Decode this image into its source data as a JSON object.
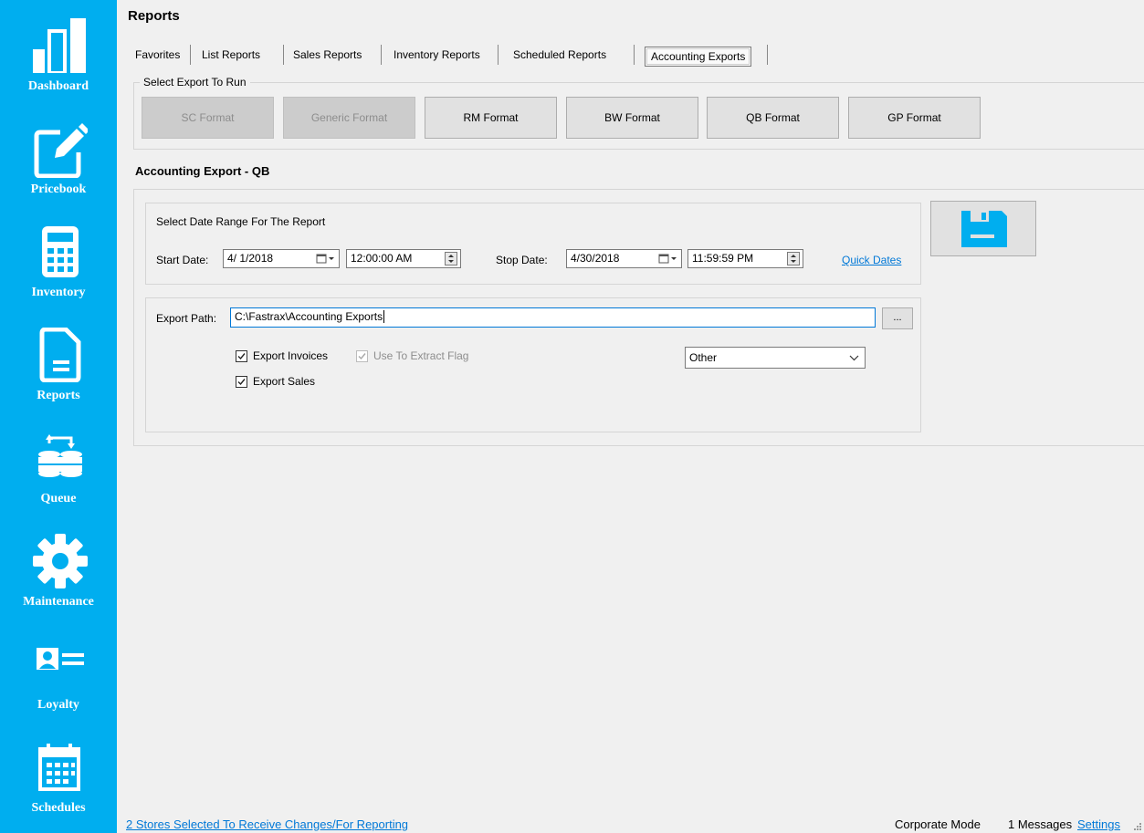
{
  "page": {
    "title": "Reports"
  },
  "sidebar": {
    "accent": "#00aeef",
    "items": [
      {
        "label": "Dashboard",
        "icon": "bar-chart-icon"
      },
      {
        "label": "Pricebook",
        "icon": "edit-document-icon"
      },
      {
        "label": "Inventory",
        "icon": "calculator-icon"
      },
      {
        "label": "Reports",
        "icon": "document-icon"
      },
      {
        "label": "Queue",
        "icon": "database-sync-icon"
      },
      {
        "label": "Maintenance",
        "icon": "gear-icon"
      },
      {
        "label": "Loyalty",
        "icon": "id-card-icon"
      },
      {
        "label": "Schedules",
        "icon": "calendar-icon"
      }
    ]
  },
  "tabs": [
    {
      "label": "Favorites"
    },
    {
      "label": "List Reports"
    },
    {
      "label": "Sales Reports"
    },
    {
      "label": "Inventory Reports"
    },
    {
      "label": "Scheduled Reports"
    },
    {
      "label": "Accounting Exports",
      "active": true
    }
  ],
  "export_select": {
    "legend": "Select Export To Run",
    "buttons": [
      {
        "label": "SC Format",
        "enabled": false
      },
      {
        "label": "Generic Format",
        "enabled": false
      },
      {
        "label": "RM Format",
        "enabled": true
      },
      {
        "label": "BW Format",
        "enabled": true
      },
      {
        "label": "QB Format",
        "enabled": true
      },
      {
        "label": "GP Format",
        "enabled": true
      }
    ]
  },
  "section_title": "Accounting Export - QB",
  "date_range": {
    "title": "Select Date Range For The Report",
    "start_label": "Start Date:",
    "start_date": "4/ 1/2018",
    "start_time": "12:00:00 AM",
    "stop_label": "Stop Date:",
    "stop_date": "4/30/2018",
    "stop_time": "11:59:59 PM",
    "quick_dates": "Quick Dates"
  },
  "export": {
    "path_label": "Export Path:",
    "path_value": "C:\\Fastrax\\Accounting Exports",
    "browse_label": "...",
    "export_invoices": {
      "label": "Export Invoices",
      "checked": true
    },
    "use_extract_flag": {
      "label": "Use To Extract Flag",
      "checked": true,
      "enabled": false
    },
    "export_sales": {
      "label": "Export Sales",
      "checked": true
    },
    "dropdown_value": "Other"
  },
  "save_button": {
    "icon": "floppy-disk-icon",
    "color": "#00aeef"
  },
  "status_bar": {
    "stores_link": "2 Stores Selected To Receive Changes/For Reporting",
    "mode": "Corporate Mode",
    "messages": "1 Messages",
    "settings": "Settings"
  }
}
